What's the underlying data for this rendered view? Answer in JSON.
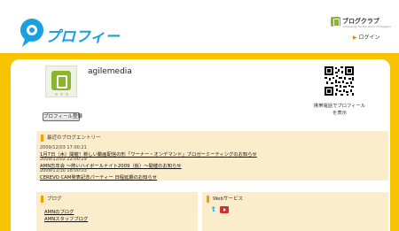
{
  "header": {
    "brand_name": "ブログクラブ",
    "brand_tagline": "community for the world of bloggers",
    "login_label": "ログイン",
    "logo_text": "プロフィール"
  },
  "profile": {
    "username": "agilemedia",
    "register_button": "プロフィール登録",
    "qr_caption_line1": "携帯電話でプロフィール",
    "qr_caption_line2": "を表示"
  },
  "entries": {
    "heading": "最近のブログエントリー",
    "items": [
      {
        "date": "2009/12/03 17:00:21",
        "title": "1月7日（木）開催！新しい動画配信の形「ワーナー・オンデマンド」ブロガーミーティングのお知らせ"
      },
      {
        "date": "2009/12/02 22:00:29",
        "title": "AMN忘年会 〜熱いハイボールナイト2009（仮）〜開催のお知らせ"
      },
      {
        "date": "2009/11/30 18:00:03",
        "title": "CEREVO CAM発表記念パーティー 日程延期のお知らせ"
      }
    ]
  },
  "blogs": {
    "heading": "ブログ",
    "items": [
      "AMNのブログ",
      "AMNスタッフブログ"
    ]
  },
  "web_services": {
    "heading": "Webサービス",
    "icons": [
      "twitter-icon",
      "youtube-icon"
    ]
  },
  "colors": {
    "frame": "#f8c300",
    "box": "#fbeccb",
    "accent": "#f0a000",
    "logo_blue": "#1a9fe0",
    "brand_green": "#8ab52c"
  }
}
